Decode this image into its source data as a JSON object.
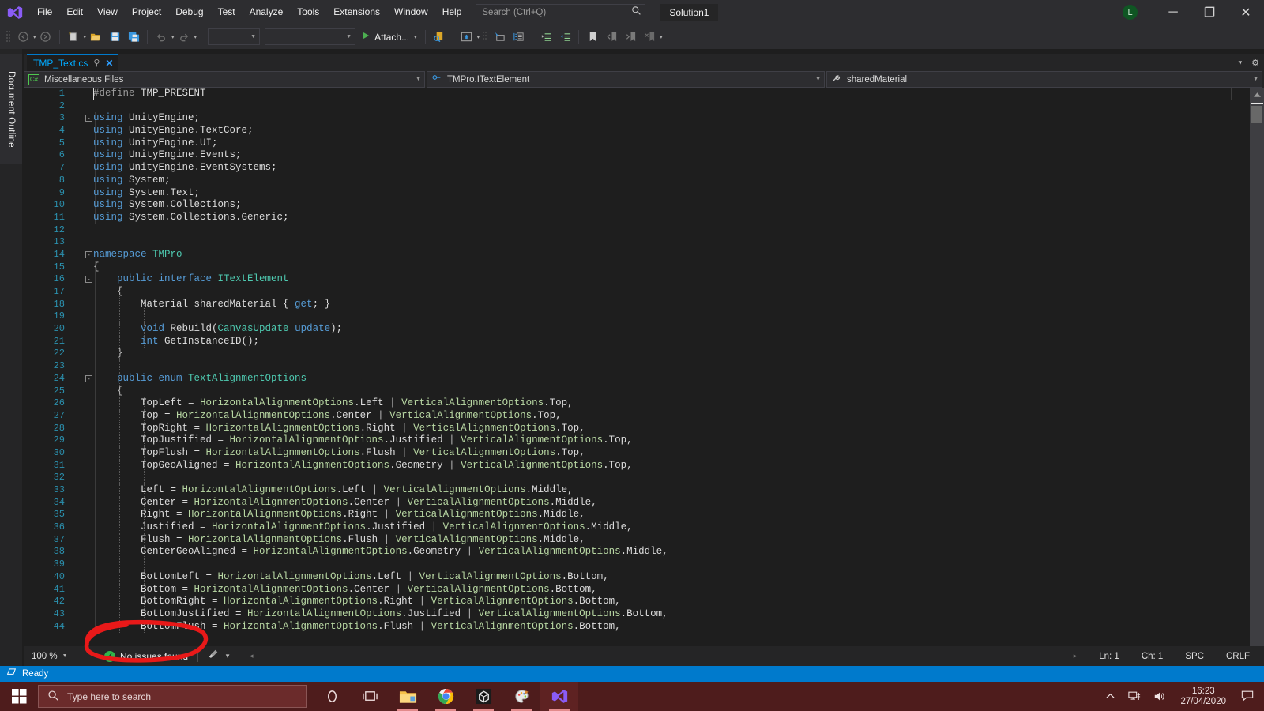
{
  "titlebar": {
    "app_icon": "visual-studio-icon",
    "menus": [
      "File",
      "Edit",
      "View",
      "Project",
      "Debug",
      "Test",
      "Analyze",
      "Tools",
      "Extensions",
      "Window",
      "Help"
    ],
    "search_placeholder": "Search (Ctrl+Q)",
    "search_icon": "search-icon",
    "solution_title": "Solution1",
    "avatar_initial": "L",
    "minimize": "─",
    "restore": "❐",
    "close": "✕"
  },
  "toolbar": {
    "navigate_back": "navigate-back-icon",
    "navigate_forward": "navigate-forward-icon",
    "new_item": "new-item-icon",
    "open_file": "open-file-icon",
    "save": "save-icon",
    "save_all": "save-all-icon",
    "undo": "undo-icon",
    "redo": "redo-icon",
    "combo1_value": "",
    "combo2_value": "",
    "attach_label": "Attach...",
    "attach_play": "play-icon",
    "right_icons": [
      "preview-icon",
      "solution-explorer-icon",
      "properties-window-icon",
      "toolbox-icon",
      "indent-icon",
      "outdent-icon",
      "bookmark-icon",
      "prev-bookmark-icon",
      "next-bookmark-icon",
      "clear-bookmark-icon"
    ]
  },
  "leftdock": {
    "tab_label": "Document Outline"
  },
  "tabstrip": {
    "tab_name": "TMP_Text.cs",
    "pin_icon": "pin-icon",
    "close_icon": "close-icon",
    "chevron_down": "▾",
    "gear": "⚙"
  },
  "navbar": {
    "project_icon": "csharp-file-icon",
    "project": "Miscellaneous Files",
    "type_icon": "interface-icon",
    "type": "TMPro.ITextElement",
    "member_icon": "property-icon",
    "member": "sharedMaterial",
    "caret": "▾"
  },
  "editor": {
    "first_line": 1,
    "caret_line": 1,
    "split_icon": "split-view-icon",
    "scroll_up_icon": "scroll-up-arrow",
    "lines": [
      {
        "n": 1,
        "fold": "",
        "segs": [
          [
            "pp",
            "#define"
          ],
          [
            "w",
            " TMP_PRESENT"
          ]
        ]
      },
      {
        "n": 2,
        "fold": "",
        "segs": []
      },
      {
        "n": 3,
        "fold": "-",
        "segs": [
          [
            "k",
            "using"
          ],
          [
            "w",
            " UnityEngine;"
          ]
        ]
      },
      {
        "n": 4,
        "fold": "",
        "segs": [
          [
            "k",
            "using"
          ],
          [
            "w",
            " UnityEngine.TextCore;"
          ]
        ]
      },
      {
        "n": 5,
        "fold": "",
        "segs": [
          [
            "k",
            "using"
          ],
          [
            "w",
            " UnityEngine.UI;"
          ]
        ]
      },
      {
        "n": 6,
        "fold": "",
        "segs": [
          [
            "k",
            "using"
          ],
          [
            "w",
            " UnityEngine.Events;"
          ]
        ]
      },
      {
        "n": 7,
        "fold": "",
        "segs": [
          [
            "k",
            "using"
          ],
          [
            "w",
            " UnityEngine.EventSystems;"
          ]
        ]
      },
      {
        "n": 8,
        "fold": "",
        "segs": [
          [
            "k",
            "using"
          ],
          [
            "w",
            " System;"
          ]
        ]
      },
      {
        "n": 9,
        "fold": "",
        "segs": [
          [
            "k",
            "using"
          ],
          [
            "w",
            " System.Text;"
          ]
        ]
      },
      {
        "n": 10,
        "fold": "",
        "segs": [
          [
            "k",
            "using"
          ],
          [
            "w",
            " System.Collections;"
          ]
        ]
      },
      {
        "n": 11,
        "fold": "",
        "segs": [
          [
            "k",
            "using"
          ],
          [
            "w",
            " System.Collections.Generic;"
          ]
        ]
      },
      {
        "n": 12,
        "fold": "",
        "segs": []
      },
      {
        "n": 13,
        "fold": "",
        "segs": []
      },
      {
        "n": 14,
        "fold": "-",
        "segs": [
          [
            "k",
            "namespace"
          ],
          [
            "t",
            " TMPro"
          ]
        ]
      },
      {
        "n": 15,
        "fold": "",
        "segs": [
          [
            "p",
            "{"
          ]
        ]
      },
      {
        "n": 16,
        "fold": "-",
        "segs": [
          [
            "w",
            "    "
          ],
          [
            "k",
            "public interface"
          ],
          [
            "t",
            " ITextElement"
          ]
        ]
      },
      {
        "n": 17,
        "fold": "",
        "segs": [
          [
            "p",
            "    {"
          ]
        ]
      },
      {
        "n": 18,
        "fold": "",
        "segs": [
          [
            "w",
            "        Material sharedMaterial { "
          ],
          [
            "k",
            "get"
          ],
          [
            "w",
            "; }"
          ]
        ]
      },
      {
        "n": 19,
        "fold": "",
        "segs": []
      },
      {
        "n": 20,
        "fold": "",
        "segs": [
          [
            "w",
            "        "
          ],
          [
            "k",
            "void"
          ],
          [
            "w",
            " Rebuild("
          ],
          [
            "t",
            "CanvasUpdate"
          ],
          [
            "w",
            " "
          ],
          [
            "k",
            "update"
          ],
          [
            "w",
            ");"
          ]
        ]
      },
      {
        "n": 21,
        "fold": "",
        "segs": [
          [
            "w",
            "        "
          ],
          [
            "k",
            "int"
          ],
          [
            "w",
            " GetInstanceID();"
          ]
        ]
      },
      {
        "n": 22,
        "fold": "",
        "segs": [
          [
            "p",
            "    }"
          ]
        ]
      },
      {
        "n": 23,
        "fold": "",
        "segs": []
      },
      {
        "n": 24,
        "fold": "-",
        "segs": [
          [
            "w",
            "    "
          ],
          [
            "k",
            "public enum"
          ],
          [
            "t",
            " TextAlignmentOptions"
          ]
        ]
      },
      {
        "n": 25,
        "fold": "",
        "segs": [
          [
            "p",
            "    {"
          ]
        ]
      },
      {
        "n": 26,
        "fold": "",
        "segs": [
          [
            "w",
            "        TopLeft = "
          ],
          [
            "en",
            "HorizontalAlignmentOptions"
          ],
          [
            "w",
            ".Left "
          ],
          [
            "p",
            "| "
          ],
          [
            "en",
            "VerticalAlignmentOptions"
          ],
          [
            "w",
            ".Top,"
          ]
        ]
      },
      {
        "n": 27,
        "fold": "",
        "segs": [
          [
            "w",
            "        Top = "
          ],
          [
            "en",
            "HorizontalAlignmentOptions"
          ],
          [
            "w",
            ".Center "
          ],
          [
            "p",
            "| "
          ],
          [
            "en",
            "VerticalAlignmentOptions"
          ],
          [
            "w",
            ".Top,"
          ]
        ]
      },
      {
        "n": 28,
        "fold": "",
        "segs": [
          [
            "w",
            "        TopRight = "
          ],
          [
            "en",
            "HorizontalAlignmentOptions"
          ],
          [
            "w",
            ".Right "
          ],
          [
            "p",
            "| "
          ],
          [
            "en",
            "VerticalAlignmentOptions"
          ],
          [
            "w",
            ".Top,"
          ]
        ]
      },
      {
        "n": 29,
        "fold": "",
        "segs": [
          [
            "w",
            "        TopJustified = "
          ],
          [
            "en",
            "HorizontalAlignmentOptions"
          ],
          [
            "w",
            ".Justified "
          ],
          [
            "p",
            "| "
          ],
          [
            "en",
            "VerticalAlignmentOptions"
          ],
          [
            "w",
            ".Top,"
          ]
        ]
      },
      {
        "n": 30,
        "fold": "",
        "segs": [
          [
            "w",
            "        TopFlush = "
          ],
          [
            "en",
            "HorizontalAlignmentOptions"
          ],
          [
            "w",
            ".Flush "
          ],
          [
            "p",
            "| "
          ],
          [
            "en",
            "VerticalAlignmentOptions"
          ],
          [
            "w",
            ".Top,"
          ]
        ]
      },
      {
        "n": 31,
        "fold": "",
        "segs": [
          [
            "w",
            "        TopGeoAligned = "
          ],
          [
            "en",
            "HorizontalAlignmentOptions"
          ],
          [
            "w",
            ".Geometry "
          ],
          [
            "p",
            "| "
          ],
          [
            "en",
            "VerticalAlignmentOptions"
          ],
          [
            "w",
            ".Top,"
          ]
        ]
      },
      {
        "n": 32,
        "fold": "",
        "segs": []
      },
      {
        "n": 33,
        "fold": "",
        "segs": [
          [
            "w",
            "        Left = "
          ],
          [
            "en",
            "HorizontalAlignmentOptions"
          ],
          [
            "w",
            ".Left "
          ],
          [
            "p",
            "| "
          ],
          [
            "en",
            "VerticalAlignmentOptions"
          ],
          [
            "w",
            ".Middle,"
          ]
        ]
      },
      {
        "n": 34,
        "fold": "",
        "segs": [
          [
            "w",
            "        Center = "
          ],
          [
            "en",
            "HorizontalAlignmentOptions"
          ],
          [
            "w",
            ".Center "
          ],
          [
            "p",
            "| "
          ],
          [
            "en",
            "VerticalAlignmentOptions"
          ],
          [
            "w",
            ".Middle,"
          ]
        ]
      },
      {
        "n": 35,
        "fold": "",
        "segs": [
          [
            "w",
            "        Right = "
          ],
          [
            "en",
            "HorizontalAlignmentOptions"
          ],
          [
            "w",
            ".Right "
          ],
          [
            "p",
            "| "
          ],
          [
            "en",
            "VerticalAlignmentOptions"
          ],
          [
            "w",
            ".Middle,"
          ]
        ]
      },
      {
        "n": 36,
        "fold": "",
        "segs": [
          [
            "w",
            "        Justified = "
          ],
          [
            "en",
            "HorizontalAlignmentOptions"
          ],
          [
            "w",
            ".Justified "
          ],
          [
            "p",
            "| "
          ],
          [
            "en",
            "VerticalAlignmentOptions"
          ],
          [
            "w",
            ".Middle,"
          ]
        ]
      },
      {
        "n": 37,
        "fold": "",
        "segs": [
          [
            "w",
            "        Flush = "
          ],
          [
            "en",
            "HorizontalAlignmentOptions"
          ],
          [
            "w",
            ".Flush "
          ],
          [
            "p",
            "| "
          ],
          [
            "en",
            "VerticalAlignmentOptions"
          ],
          [
            "w",
            ".Middle,"
          ]
        ]
      },
      {
        "n": 38,
        "fold": "",
        "segs": [
          [
            "w",
            "        CenterGeoAligned = "
          ],
          [
            "en",
            "HorizontalAlignmentOptions"
          ],
          [
            "w",
            ".Geometry "
          ],
          [
            "p",
            "| "
          ],
          [
            "en",
            "VerticalAlignmentOptions"
          ],
          [
            "w",
            ".Middle,"
          ]
        ]
      },
      {
        "n": 39,
        "fold": "",
        "segs": []
      },
      {
        "n": 40,
        "fold": "",
        "segs": [
          [
            "w",
            "        BottomLeft = "
          ],
          [
            "en",
            "HorizontalAlignmentOptions"
          ],
          [
            "w",
            ".Left "
          ],
          [
            "p",
            "| "
          ],
          [
            "en",
            "VerticalAlignmentOptions"
          ],
          [
            "w",
            ".Bottom,"
          ]
        ]
      },
      {
        "n": 41,
        "fold": "",
        "segs": [
          [
            "w",
            "        Bottom = "
          ],
          [
            "en",
            "HorizontalAlignmentOptions"
          ],
          [
            "w",
            ".Center "
          ],
          [
            "p",
            "| "
          ],
          [
            "en",
            "VerticalAlignmentOptions"
          ],
          [
            "w",
            ".Bottom,"
          ]
        ]
      },
      {
        "n": 42,
        "fold": "",
        "segs": [
          [
            "w",
            "        BottomRight = "
          ],
          [
            "en",
            "HorizontalAlignmentOptions"
          ],
          [
            "w",
            ".Right "
          ],
          [
            "p",
            "| "
          ],
          [
            "en",
            "VerticalAlignmentOptions"
          ],
          [
            "w",
            ".Bottom,"
          ]
        ]
      },
      {
        "n": 43,
        "fold": "",
        "segs": [
          [
            "w",
            "        BottomJustified = "
          ],
          [
            "en",
            "HorizontalAlignmentOptions"
          ],
          [
            "w",
            ".Justified "
          ],
          [
            "p",
            "| "
          ],
          [
            "en",
            "VerticalAlignmentOptions"
          ],
          [
            "w",
            ".Bottom,"
          ]
        ]
      },
      {
        "n": 44,
        "fold": "",
        "segs": [
          [
            "w",
            "        BottomFlush = "
          ],
          [
            "en",
            "HorizontalAlignmentOptions"
          ],
          [
            "w",
            ".Flush "
          ],
          [
            "p",
            "| "
          ],
          [
            "en",
            "VerticalAlignmentOptions"
          ],
          [
            "w",
            ".Bottom,"
          ]
        ]
      }
    ]
  },
  "editor_status": {
    "zoom": "100 %",
    "issues_text": "No issues found",
    "issues_icon": "check-circle-icon",
    "brush_icon": "brush-icon",
    "prev_icon": "◂",
    "next_icon": "▸",
    "line": "Ln: 1",
    "col": "Ch: 1",
    "spaces": "SPC",
    "eol": "CRLF"
  },
  "statusbar": {
    "ready": "Ready",
    "icon": "window-icon"
  },
  "taskbar": {
    "start_icon": "windows-start-icon",
    "search_placeholder": "Type here to search",
    "search_icon": "search-icon",
    "items": [
      {
        "name": "cortana-icon"
      },
      {
        "name": "task-view-icon"
      },
      {
        "name": "file-explorer-icon"
      },
      {
        "name": "chrome-icon"
      },
      {
        "name": "unity-icon"
      },
      {
        "name": "paint-3d-icon"
      },
      {
        "name": "visual-studio-icon"
      }
    ],
    "tray": {
      "chevron": "show-hidden-icons",
      "network": "network-icon",
      "volume": "volume-icon",
      "time": "16:23",
      "date": "27/04/2020",
      "notifications": "action-center-icon"
    }
  },
  "annotation": {
    "shape": "red-ellipse-highlight",
    "color": "#e81919"
  }
}
